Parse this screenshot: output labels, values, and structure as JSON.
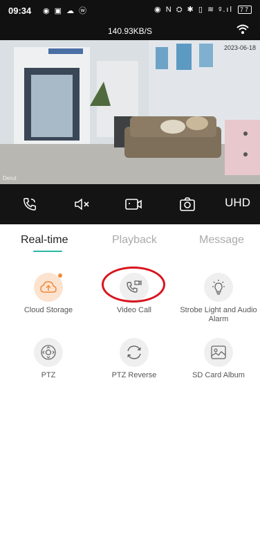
{
  "status_bar": {
    "time": "09:34",
    "left_icons": "◉ ▣ ☁ ⓦ",
    "right_icons": "◉ N ⛭ ✱ ▯ ≋ ᵍ.ıl",
    "battery": "77"
  },
  "stream": {
    "speed": "140.93KB/S"
  },
  "video": {
    "overlay_text": "Derut",
    "timestamp": "2023-06-18"
  },
  "controls": {
    "quality": "UHD"
  },
  "tabs": [
    "Real-time",
    "Playback",
    "Message"
  ],
  "features": [
    {
      "label": "Cloud Storage",
      "icon": "cloud-upload-icon"
    },
    {
      "label": "Video Call",
      "icon": "video-call-icon"
    },
    {
      "label": "Strobe Light and Audio Alarm",
      "icon": "bulb-icon"
    },
    {
      "label": "PTZ",
      "icon": "ptz-icon"
    },
    {
      "label": "PTZ Reverse",
      "icon": "reverse-icon"
    },
    {
      "label": "SD Card Album",
      "icon": "image-icon"
    }
  ],
  "colors": {
    "accent": "#2bb6a8",
    "orange": "#f08a3c",
    "highlight": "#d8141c"
  }
}
